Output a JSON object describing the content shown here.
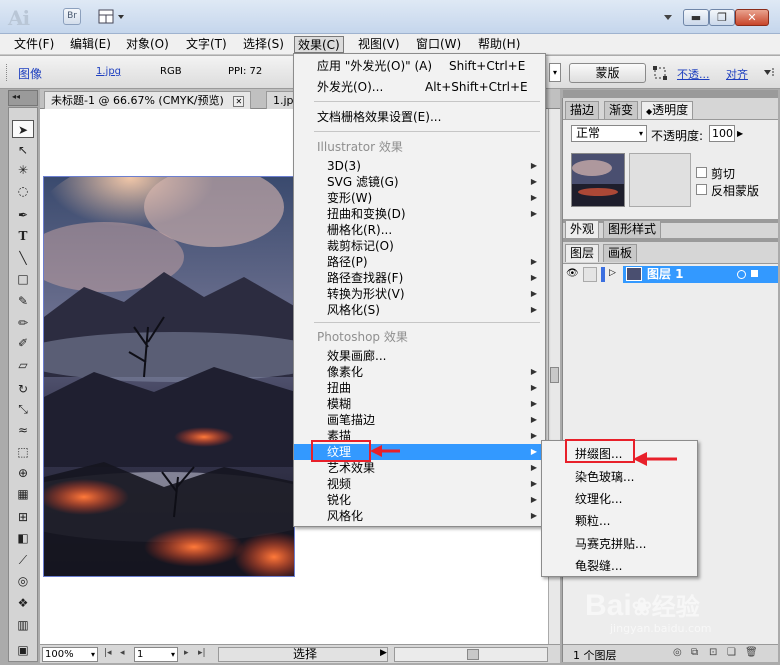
{
  "app": {
    "logo": "Ai",
    "bridge": "Br"
  },
  "menubar": [
    "文件(F)",
    "编辑(E)",
    "对象(O)",
    "文字(T)",
    "选择(S)",
    "效果(C)",
    "视图(V)",
    "窗口(W)",
    "帮助(H)"
  ],
  "control": {
    "label": "图像",
    "file": "1.jpg",
    "mode": "RGB",
    "ppi": "PPI: 72",
    "mask_btn": "蒙版",
    "opacity_link": "不透...",
    "align_link": "对齐"
  },
  "tabs": [
    "未标题-1 @ 66.67% (CMYK/预览)",
    "1.jp"
  ],
  "effects_menu": {
    "apply_last": "应用 \"外发光(O)\" (A)",
    "apply_last_key": "Shift+Ctrl+E",
    "last": "外发光(O)...",
    "last_key": "Alt+Shift+Ctrl+E",
    "raster_settings": "文档栅格效果设置(E)...",
    "illustrator_header": "Illustrator 效果",
    "illustrator": [
      "3D(3)",
      "SVG 滤镜(G)",
      "变形(W)",
      "扭曲和变换(D)",
      "栅格化(R)...",
      "裁剪标记(O)",
      "路径(P)",
      "路径查找器(F)",
      "转换为形状(V)",
      "风格化(S)"
    ],
    "photoshop_header": "Photoshop 效果",
    "photoshop": [
      "效果画廊...",
      "像素化",
      "扭曲",
      "模糊",
      "画笔描边",
      "素描",
      "纹理",
      "艺术效果",
      "视频",
      "锐化",
      "风格化"
    ]
  },
  "texture_submenu": [
    "拼缀图...",
    "染色玻璃...",
    "纹理化...",
    "颗粒...",
    "马赛克拼贴...",
    "龟裂缝..."
  ],
  "panels": {
    "top_tabs": [
      "描边",
      "渐变",
      "透明度"
    ],
    "blend": "正常",
    "opacity_label": "不透明度:",
    "opacity_value": "100",
    "clip": "剪切",
    "invert": "反相蒙版",
    "mid_tabs": [
      "外观",
      "图形样式"
    ],
    "layer_tabs": [
      "图层",
      "画板"
    ],
    "layer_name": "图层 1",
    "layer_count": "1 个图层"
  },
  "status": {
    "zoom": "100%",
    "page": "1",
    "tool": "选择"
  },
  "watermark": {
    "brand": "Bai",
    "brand2": "经验",
    "url": "jingyan.baidu.com"
  },
  "colors": {
    "highlight": "#3399ff",
    "annotation": "#e8202a"
  }
}
